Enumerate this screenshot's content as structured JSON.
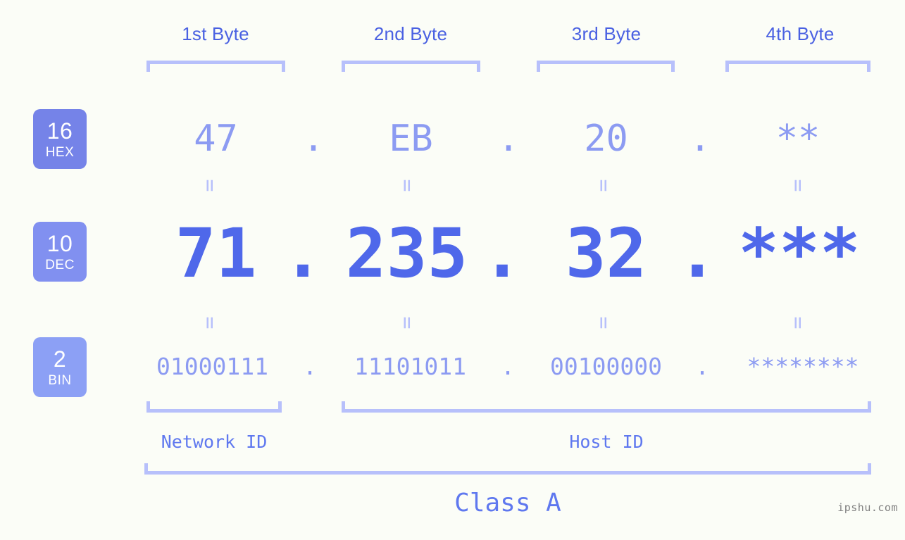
{
  "background_color": "#fbfdf7",
  "accent_colors": {
    "header_blue": "#4a61e2",
    "bracket_lilac": "#b7c0fb",
    "value_light": "#8c9bf2",
    "value_strong": "#4f68ea",
    "badge_hex": "#7583e8",
    "badge_dec": "#8190f0",
    "badge_bin": "#8ca0f5",
    "watermark_gray": "#808080"
  },
  "byte_headers": [
    {
      "label": "1st Byte"
    },
    {
      "label": "2nd Byte"
    },
    {
      "label": "3rd Byte"
    },
    {
      "label": "4th Byte"
    }
  ],
  "bases": [
    {
      "number": "16",
      "label": "HEX"
    },
    {
      "number": "10",
      "label": "DEC"
    },
    {
      "number": "2",
      "label": "BIN"
    }
  ],
  "separator": ".",
  "equals_glyph": "=",
  "rows": {
    "hex": {
      "base_number": "16",
      "base_label": "HEX",
      "octets": [
        "47",
        "EB",
        "20",
        "**"
      ]
    },
    "dec": {
      "base_number": "10",
      "base_label": "DEC",
      "octets": [
        "71",
        "235",
        "32",
        "***"
      ]
    },
    "bin": {
      "base_number": "2",
      "base_label": "BIN",
      "octets": [
        "01000111",
        "11101011",
        "00100000",
        "********"
      ]
    }
  },
  "segments": {
    "network_id": "Network ID",
    "host_id": "Host ID"
  },
  "class_label": "Class A",
  "watermark": "ipshu.com"
}
